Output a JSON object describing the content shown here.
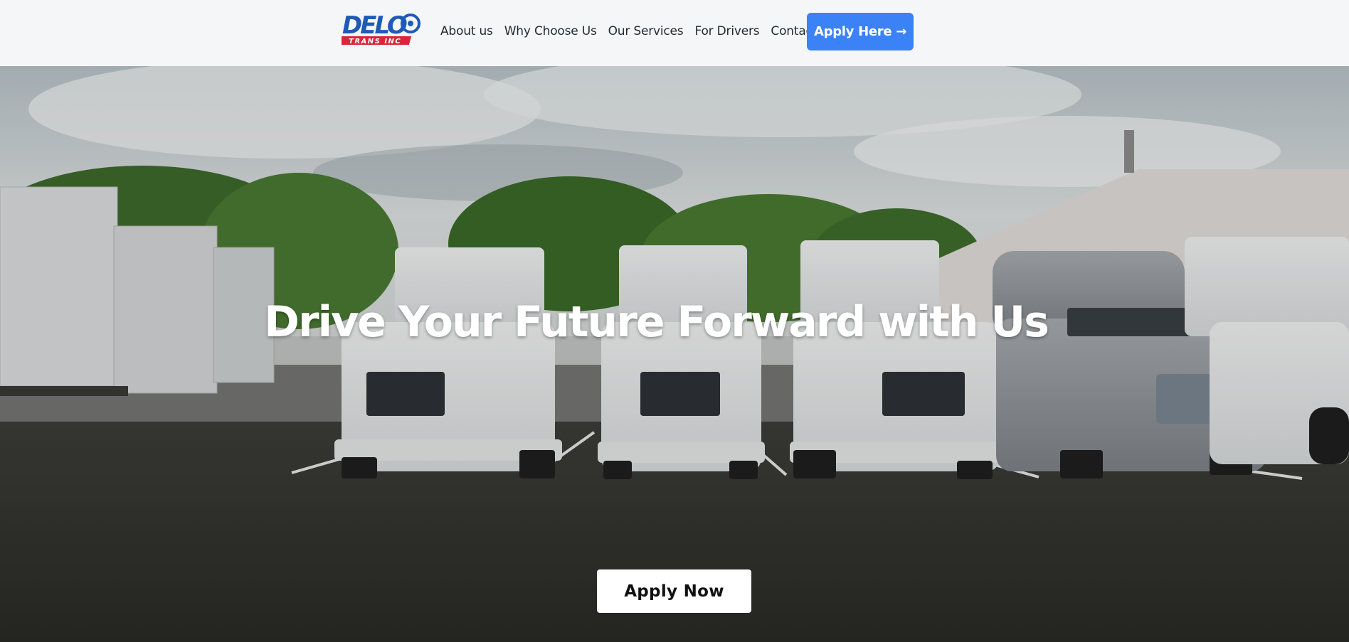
{
  "brand": {
    "logo_main": "DELO",
    "logo_sub": "TRANS INC"
  },
  "nav": {
    "items": [
      {
        "label": "About us"
      },
      {
        "label": "Why Choose Us"
      },
      {
        "label": "Our Services"
      },
      {
        "label": "For Drivers"
      },
      {
        "label": "Contacts"
      }
    ],
    "cta_label": "Apply Here →"
  },
  "hero": {
    "headline": "Drive Your Future Forward with Us",
    "cta_label": "Apply Now",
    "image_icon": "trucks-parking-lot-photo"
  },
  "colors": {
    "accent": "#3b82f6",
    "header_bg": "#f5f6f7",
    "logo_blue": "#1e5bb8",
    "logo_red": "#d9263a"
  }
}
